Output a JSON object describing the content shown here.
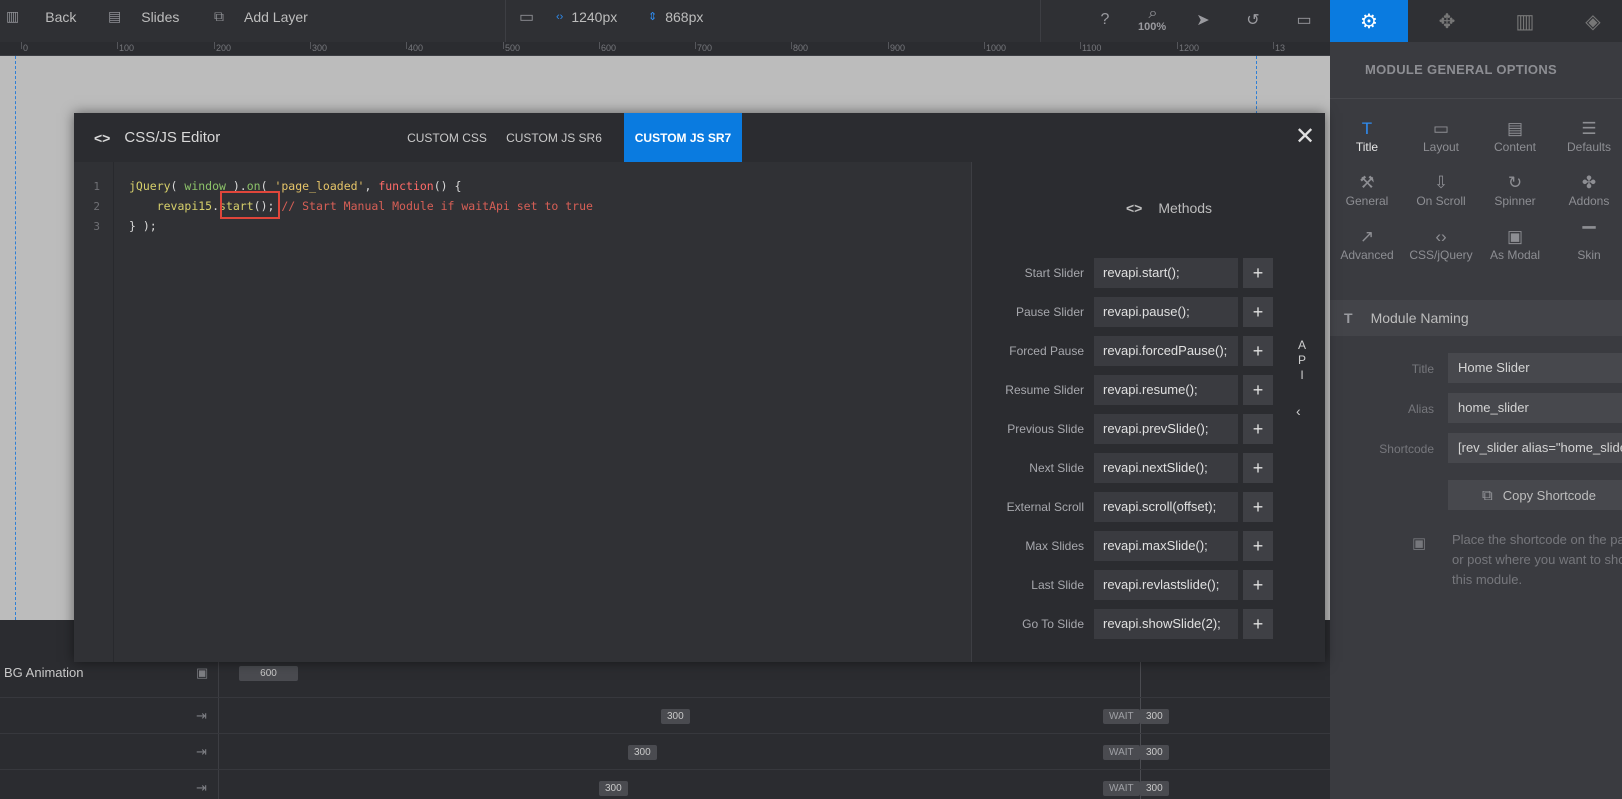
{
  "toolbar": {
    "back_label": "Back",
    "slides_label": "Slides",
    "add_layer_label": "Add Layer",
    "width_value": "1240px",
    "height_value": "868px",
    "zoom_label": "100%"
  },
  "ruler": {
    "labels": [
      "0",
      "100",
      "200",
      "300",
      "400",
      "500",
      "600",
      "700",
      "800",
      "900",
      "1000",
      "1100",
      "1200",
      "13"
    ]
  },
  "modal": {
    "title": "CSS/JS Editor",
    "tabs": [
      {
        "label": "CUSTOM CSS",
        "active": false
      },
      {
        "label": "CUSTOM JS SR6",
        "active": false
      },
      {
        "label": "CUSTOM JS SR7",
        "active": true
      }
    ],
    "close_label": "✕",
    "line_numbers": [
      "1",
      "2",
      "3"
    ],
    "code": {
      "l1_fn": "jQuery",
      "l1_open": "( ",
      "l1_window": "window",
      "l1_mid": " ).",
      "l1_on": "on",
      "l1_paren": "( ",
      "l1_string": "'page_loaded'",
      "l1_comma": ", ",
      "l1_function": "function",
      "l1_end": "() {",
      "l2_indent": "    ",
      "l2_obj": "revapi15",
      "l2_dot": ".",
      "l2_method": "start",
      "l2_call": "();",
      "l2_comment": " // Start Manual Module if waitApi set to true",
      "l3": "} );"
    },
    "methods": {
      "title": "Methods",
      "items": [
        {
          "label": "Start Slider",
          "code": "revapi.start();"
        },
        {
          "label": "Pause Slider",
          "code": "revapi.pause();"
        },
        {
          "label": "Forced Pause",
          "code": "revapi.forcedPause();"
        },
        {
          "label": "Resume Slider",
          "code": "revapi.resume();"
        },
        {
          "label": "Previous Slide",
          "code": "revapi.prevSlide();"
        },
        {
          "label": "Next Slide",
          "code": "revapi.nextSlide();"
        },
        {
          "label": "External Scroll",
          "code": "revapi.scroll(offset);"
        },
        {
          "label": "Max Slides",
          "code": "revapi.maxSlide();"
        },
        {
          "label": "Last Slide",
          "code": "revapi.revlastslide();"
        },
        {
          "label": "Go To Slide",
          "code": "revapi.showSlide(2);"
        }
      ],
      "add_label": "+"
    },
    "api_letters": [
      "A",
      "P",
      "I"
    ],
    "api_arrow": "‹"
  },
  "timeline": {
    "rows": [
      {
        "label": "BG Animation",
        "chips": [
          {
            "text": "600"
          }
        ]
      },
      {
        "label": "",
        "chips": [
          {
            "text": "300"
          },
          {
            "text": "WAIT"
          },
          {
            "text": "300"
          }
        ]
      },
      {
        "label": "",
        "chips": [
          {
            "text": "300"
          },
          {
            "text": "WAIT"
          },
          {
            "text": "300"
          }
        ]
      },
      {
        "label": "",
        "chips": [
          {
            "text": "300"
          },
          {
            "text": "WAIT"
          },
          {
            "text": "300"
          }
        ]
      }
    ]
  },
  "panel": {
    "title": "MODULE GENERAL OPTIONS",
    "options": [
      {
        "label": "Title",
        "icon": "title-icon",
        "active": true
      },
      {
        "label": "Layout",
        "icon": "layout-icon",
        "active": false
      },
      {
        "label": "Content",
        "icon": "content-icon",
        "active": false
      },
      {
        "label": "Defaults",
        "icon": "defaults-icon",
        "active": false
      },
      {
        "label": "General",
        "icon": "wrench-icon",
        "active": false
      },
      {
        "label": "On Scroll",
        "icon": "on-scroll-icon",
        "active": false
      },
      {
        "label": "Spinner",
        "icon": "spinner-icon",
        "active": false
      },
      {
        "label": "Addons",
        "icon": "puzzle-icon",
        "active": false
      },
      {
        "label": "Advanced",
        "icon": "chart-line-icon",
        "active": false
      },
      {
        "label": "CSS/jQuery",
        "icon": "code-icon",
        "active": false
      },
      {
        "label": "As Modal",
        "icon": "modal-icon",
        "active": false
      },
      {
        "label": "Skin",
        "icon": "paint-roller-icon",
        "active": false
      }
    ],
    "section_title": "Module Naming",
    "fields": {
      "title_label": "Title",
      "title_value": "Home Slider",
      "alias_label": "Alias",
      "alias_value": "home_slider",
      "shortcode_label": "Shortcode",
      "shortcode_value": "[rev_slider alias=\"home_slider\"][/rev_slider]"
    },
    "copy_label": "Copy Shortcode",
    "hint": "Place the shortcode on the page or post where you want to show this module."
  },
  "colors": {
    "accent": "#0a7be0",
    "highlight_box": "#e0463b"
  }
}
